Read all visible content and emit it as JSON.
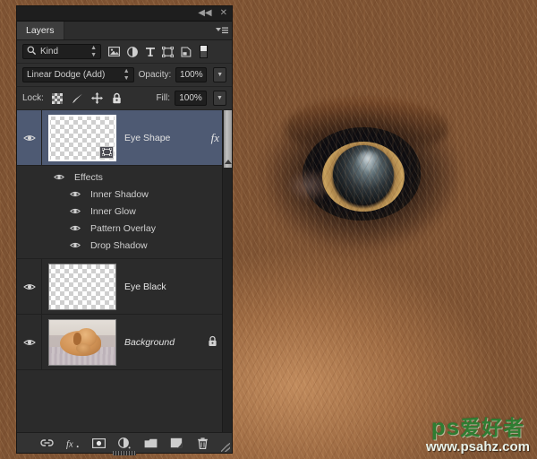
{
  "window": {
    "collapse_label": "◀◀",
    "close_label": "✕"
  },
  "tabs": [
    {
      "label": "Layers",
      "active": true
    }
  ],
  "panel_menu_icon": "panel-menu-icon",
  "filter": {
    "search_icon": "search-icon",
    "kind_value": "Kind",
    "icons": [
      "pixel-filter-icon",
      "adjustment-filter-icon",
      "type-filter-icon",
      "shape-filter-icon",
      "smart-object-filter-icon"
    ],
    "toggle_name": "filter-enable-toggle"
  },
  "blend": {
    "mode_value": "Linear Dodge (Add)",
    "opacity_label": "Opacity:",
    "opacity_value": "100%"
  },
  "lock": {
    "label": "Lock:",
    "items": [
      "lock-transparency-icon",
      "lock-image-icon",
      "lock-position-icon",
      "lock-all-icon"
    ],
    "fill_label": "Fill:",
    "fill_value": "100%"
  },
  "layers": [
    {
      "name": "Eye Shape",
      "selected": true,
      "visible": true,
      "fx_label": "fx",
      "thumb_type": "transparent-vector",
      "locked": false,
      "italic": false
    },
    {
      "name": "Eye Black",
      "selected": false,
      "visible": true,
      "fx_label": "",
      "thumb_type": "transparent",
      "locked": false,
      "italic": false
    },
    {
      "name": "Background",
      "selected": false,
      "visible": true,
      "fx_label": "",
      "thumb_type": "photo-dog",
      "locked": true,
      "lock_icon": "lock-icon",
      "italic": true
    }
  ],
  "effects": {
    "group_label": "Effects",
    "items": [
      {
        "label": "Inner Shadow",
        "visible": true
      },
      {
        "label": "Inner Glow",
        "visible": true
      },
      {
        "label": "Pattern Overlay",
        "visible": true
      },
      {
        "label": "Drop Shadow",
        "visible": true
      }
    ]
  },
  "bottom_toolbar": [
    "link-layers-icon",
    "layer-style-fx-icon",
    "add-mask-icon",
    "new-adjustment-layer-icon",
    "new-group-icon",
    "new-layer-icon",
    "delete-layer-icon"
  ],
  "watermark": {
    "brand": "ps",
    "brand_cn": "爱好者",
    "url": "www.psahz.com"
  }
}
